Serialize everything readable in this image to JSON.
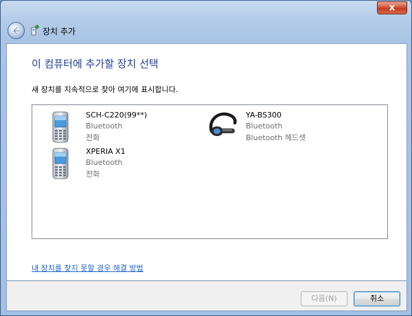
{
  "window": {
    "title": "장치 추가",
    "close_label": "x"
  },
  "main": {
    "heading": "이 컴퓨터에 추가할 장치 선택",
    "subtext": "새 장치를 지속적으로 찾아 여기에 표시합니다."
  },
  "devices": [
    {
      "name": "SCH-C220(99**)",
      "type": "Bluetooth",
      "category": "전화",
      "icon": "phone-icon"
    },
    {
      "name": "XPERIA X1",
      "type": "Bluetooth",
      "category": "전화",
      "icon": "phone-icon"
    },
    {
      "name": "YA-BS300",
      "type": "Bluetooth",
      "category": "Bluetooth 헤드셋",
      "icon": "headset-icon"
    }
  ],
  "help_link": "내 장치를 찾지 못할 경우 해결 방법",
  "buttons": {
    "next": "다음(N)",
    "cancel": "취소"
  }
}
